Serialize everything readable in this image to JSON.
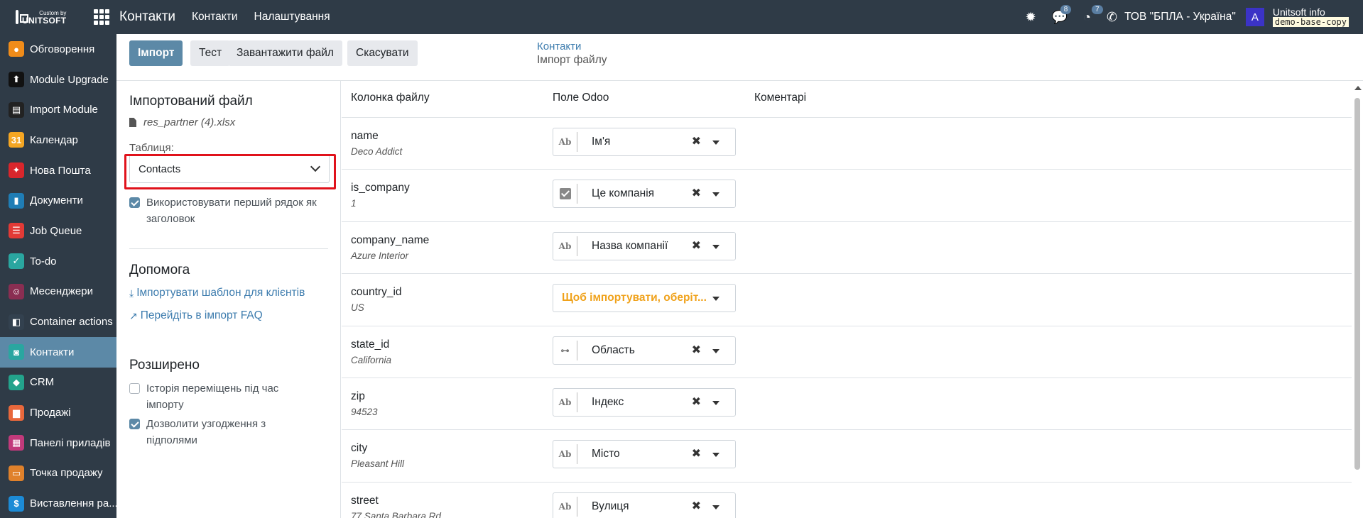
{
  "brand": {
    "line1": "Custom by",
    "line2": "UNITSOFT"
  },
  "navbar": {
    "app_title": "Контакти",
    "menu": [
      "Контакти",
      "Налаштування"
    ],
    "messages_count": "8",
    "activities_count": "7",
    "company": "ТОВ \"БПЛА - Україна\"",
    "avatar_letter": "A",
    "user_name": "Unitsoft info",
    "db_name": "demo-base-copy"
  },
  "sidebar": {
    "items": [
      {
        "label": "Обговорення",
        "icon": "discuss-icon",
        "color": "#f08c1a"
      },
      {
        "label": "Module Upgrade",
        "icon": "upload-icon",
        "color": "#111111"
      },
      {
        "label": "Import Module",
        "icon": "import-module-icon",
        "color": "#222222"
      },
      {
        "label": "Календар",
        "icon": "calendar-icon",
        "color": "#f5a623"
      },
      {
        "label": "Нова Пошта",
        "icon": "nova-poshta-icon",
        "color": "#d9262c"
      },
      {
        "label": "Документи",
        "icon": "documents-icon",
        "color": "#1f7db5"
      },
      {
        "label": "Job Queue",
        "icon": "job-queue-icon",
        "color": "#e23a36"
      },
      {
        "label": "To-do",
        "icon": "todo-icon",
        "color": "#2aa6a0"
      },
      {
        "label": "Месенджери",
        "icon": "messengers-icon",
        "color": "#8a2e52"
      },
      {
        "label": "Container actions",
        "icon": "container-icon",
        "color": "#33414f"
      },
      {
        "label": "Контакти",
        "icon": "contacts-icon",
        "color": "#2aa6a0"
      },
      {
        "label": "CRM",
        "icon": "crm-icon",
        "color": "#23a38c"
      },
      {
        "label": "Продажі",
        "icon": "sales-icon",
        "color": "#e8683c"
      },
      {
        "label": "Панелі приладів",
        "icon": "dashboards-icon",
        "color": "#c13a7b"
      },
      {
        "label": "Точка продажу",
        "icon": "pos-icon",
        "color": "#e0812b"
      },
      {
        "label": "Виставлення ра...",
        "icon": "invoicing-icon",
        "color": "#1c8bd6"
      }
    ]
  },
  "control_panel": {
    "buttons": {
      "import": "Імпорт",
      "test": "Тест",
      "load_file": "Завантажити файл",
      "cancel": "Скасувати"
    },
    "breadcrumb_parent": "Контакти",
    "breadcrumb_current": "Імпорт файлу"
  },
  "left_panel": {
    "imported_file_title": "Імпортований файл",
    "filename": "res_partner (4).xlsx",
    "table_label": "Таблиця:",
    "table_value": "Contacts",
    "first_row_header": "Використовувати перший рядок як заголовок",
    "help_title": "Допомога",
    "help_template": "Імпортувати шаблон для клієнтів",
    "help_faq": "Перейдіть в імпорт FAQ",
    "advanced_title": "Розширено",
    "track_history": "Історія переміщень під час імпорту",
    "allow_subfields": "Дозволити узгодження з підполями"
  },
  "table": {
    "headers": {
      "file_column": "Колонка файлу",
      "odoo_field": "Поле Odoo",
      "comments": "Коментарі"
    },
    "rows": [
      {
        "column": "name",
        "sample": "Deco Addict",
        "field": "Ім'я",
        "type_icon": "char-icon",
        "type_glyph": "Ab",
        "warn": false
      },
      {
        "column": "is_company",
        "sample": "1",
        "field": "Це компанія",
        "type_icon": "boolean-icon",
        "type_glyph": "",
        "warn": false
      },
      {
        "column": "company_name",
        "sample": "Azure Interior",
        "field": "Назва компанії",
        "type_icon": "char-icon",
        "type_glyph": "Ab",
        "warn": false
      },
      {
        "column": "country_id",
        "sample": "US",
        "field": "Щоб імпортувати, оберіт...",
        "type_icon": "",
        "type_glyph": "",
        "warn": true
      },
      {
        "column": "state_id",
        "sample": "California",
        "field": "Область",
        "type_icon": "relation-icon",
        "type_glyph": "⊶",
        "warn": false
      },
      {
        "column": "zip",
        "sample": "94523",
        "field": "Індекс",
        "type_icon": "char-icon",
        "type_glyph": "Ab",
        "warn": false
      },
      {
        "column": "city",
        "sample": "Pleasant Hill",
        "field": "Місто",
        "type_icon": "char-icon",
        "type_glyph": "Ab",
        "warn": false
      },
      {
        "column": "street",
        "sample": "77 Santa Barbara Rd",
        "field": "Вулиця",
        "type_icon": "char-icon",
        "type_glyph": "Ab",
        "warn": false
      }
    ]
  }
}
